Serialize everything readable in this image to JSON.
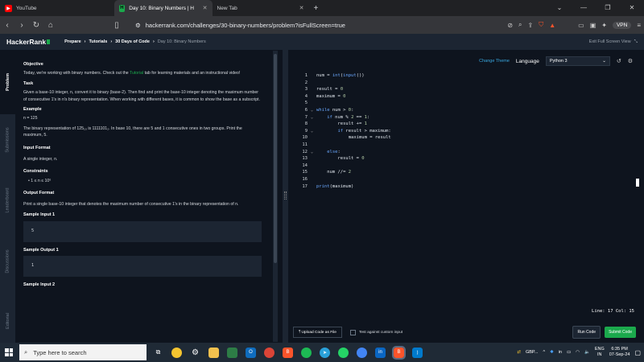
{
  "browser": {
    "tabs": [
      {
        "label": "YouTube",
        "icon": "youtube-icon",
        "active": false
      },
      {
        "label": "Day 10: Binary Numbers | Hacke",
        "icon": "hackerrank-icon",
        "active": true
      },
      {
        "label": "New Tab",
        "icon": "",
        "active": false
      }
    ],
    "new_tab_symbol": "+",
    "url": "hackerrank.com/challenges/30-binary-numbers/problem?isFullScreen=true",
    "vpn_label": "VPN"
  },
  "header": {
    "logo": "HackerRank",
    "breadcrumbs": [
      "Prepare",
      "Tutorials",
      "30 Days of Code"
    ],
    "current": "Day 10: Binary Numbers",
    "exit_fullscreen": "Exit Full Screen View"
  },
  "side_tabs": [
    "Problem",
    "Submissions",
    "Leaderboard",
    "Discussions",
    "Editorial"
  ],
  "problem": {
    "objective_h": "Objective",
    "objective_1": "Today, we're working with binary numbers. Check out the",
    "objective_link": "Tutorial",
    "objective_2": "tab for learning materials and an instructional video!",
    "task_h": "Task",
    "task": "Given a base-10 integer, n, convert it to binary (base-2). Then find and print the base-10 integer denoting the maximum number of consecutive 1's in n's binary representation. When working with different bases, it is common to show the base as a subscript.",
    "example_h": "Example",
    "example_n": "n = 125",
    "example_text": "The binary representation of 125₁₀ is 1111101₂. In base 10, there are 5 and 1 consecutive ones in two groups. Print the maximum, 5.",
    "input_h": "Input Format",
    "input": "A single integer, n.",
    "constraints_h": "Constraints",
    "constraint": "1 ≤ n ≤ 10⁶",
    "output_h": "Output Format",
    "output": "Print a single base-10 integer that denotes the maximum number of consecutive 1's in the binary representation of n.",
    "sample_input_1_h": "Sample Input 1",
    "sample_input_1": "5",
    "sample_output_1_h": "Sample Output 1",
    "sample_output_1": "1",
    "sample_input_2_h": "Sample Input 2"
  },
  "editor": {
    "change_theme": "Change Theme",
    "language_label": "Language",
    "language": "Python 3",
    "status": "Line: 17 Col: 15",
    "upload": "Upload Code as File",
    "custom_input": "Test against custom input",
    "run": "Run Code",
    "submit": "Submit Code"
  },
  "taskbar": {
    "search_placeholder": "Type here to search",
    "currency": "GBP...",
    "lang_1": "ENG",
    "lang_2": "IN",
    "time": "6:35 PM",
    "date": "07-Sep-24"
  },
  "colors": {
    "accent_green": "#1ba94c",
    "link_blue": "#39a8e0",
    "bg": "#0e141e"
  }
}
